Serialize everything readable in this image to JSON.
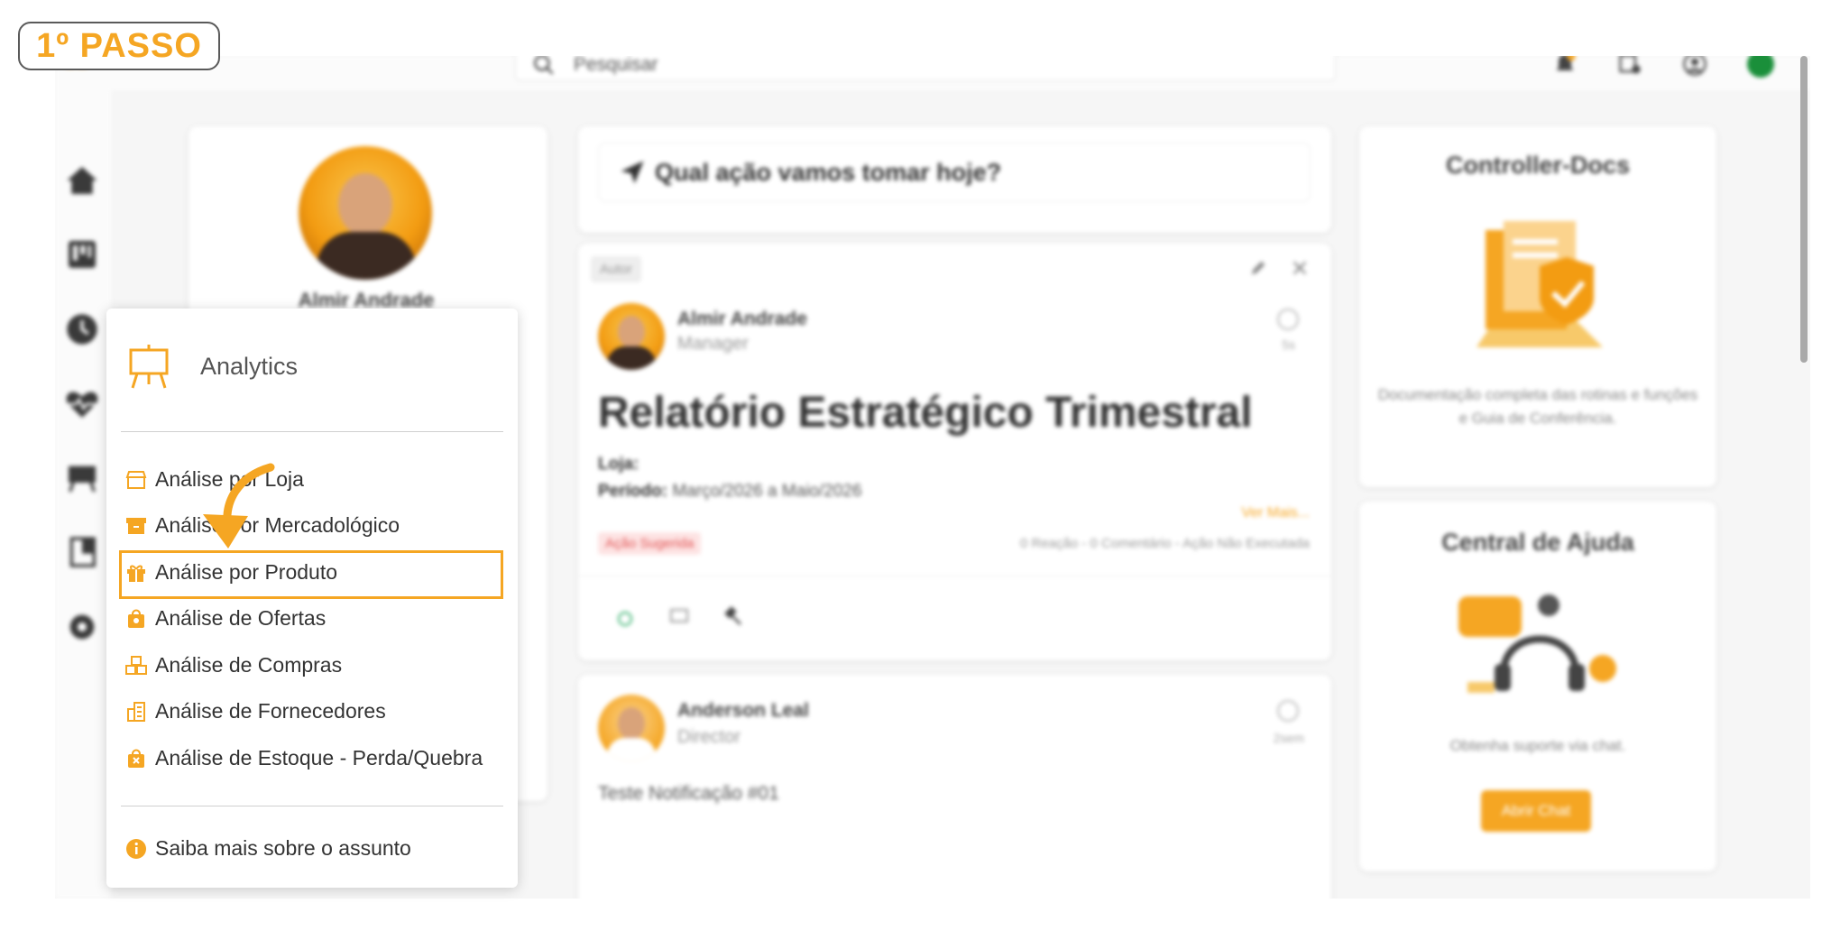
{
  "step_label": "1º PASSO",
  "topbar": {
    "search_placeholder": "Pesquisar"
  },
  "profile": {
    "name": "Almir Andrade"
  },
  "feed": {
    "question": "Qual ação vamos tomar hoje?",
    "post1": {
      "tag": "Autor",
      "author": "Almir Andrade",
      "role": "Manager",
      "time": "5s",
      "title": "Relatório Estratégico Trimestral",
      "store_label": "Loja:",
      "period_label": "Período:",
      "period_value": "Março/2026 a Maio/2026",
      "see_more": "Ver Mais...",
      "badge": "Ação Sugerida",
      "meta": "0 Reação - 0 Comentário - Ação Não Executada"
    },
    "post2": {
      "author": "Anderson Leal",
      "role": "Director",
      "time": "2sem",
      "text": "Teste Notificação #01"
    }
  },
  "right": {
    "docs_title": "Controller-Docs",
    "docs_text": "Documentação completa das rotinas e funções e Guia de Conferência.",
    "help_title": "Central de Ajuda",
    "help_text": "Obtenha suporte via chat.",
    "help_button": "Abrir Chat"
  },
  "menu": {
    "title": "Analytics",
    "items": [
      {
        "label": "Análise por Loja",
        "icon": "store-icon"
      },
      {
        "label": "Análise por Mercadológico",
        "icon": "archive-box-icon"
      },
      {
        "label": "Análise por Produto",
        "icon": "gift-icon"
      },
      {
        "label": "Análise de Ofertas",
        "icon": "shopping-bag-icon"
      },
      {
        "label": "Análise de Compras",
        "icon": "cubes-icon"
      },
      {
        "label": "Análise de Fornecedores",
        "icon": "building-icon"
      },
      {
        "label": "Análise de Estoque - Perda/Quebra",
        "icon": "bag-x-icon"
      }
    ],
    "footer_link": "Saiba mais sobre o assunto",
    "highlighted_item": "Análise por Produto"
  },
  "colors": {
    "accent": "#f5a623",
    "status_online": "#1a8f3a"
  }
}
